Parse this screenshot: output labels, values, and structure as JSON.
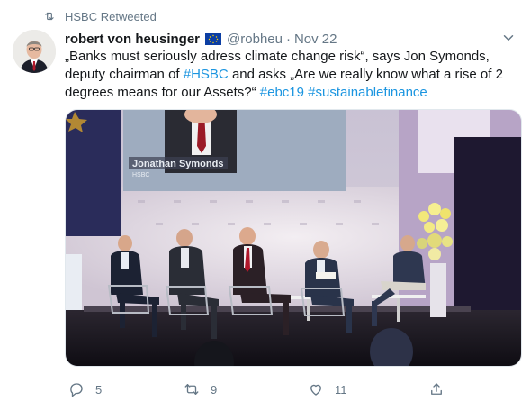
{
  "retweet": {
    "label": "HSBC Retweeted",
    "icon": "retweet-icon"
  },
  "author": {
    "display_name": "robert von heusinger",
    "flag_icon": "eu-flag-icon",
    "handle": "@robheu",
    "separator": "·",
    "time": "Nov 22"
  },
  "tweet": {
    "text_part1": "„Banks must seriously adress climate change risk“, says Jon Symonds, deputy chairman of ",
    "mention": "#HSBC",
    "text_part2": " and asks „Are we really know what a rise of 2 degrees means for our Assets?“ ",
    "hashtag1": "#ebc19",
    "hashtag2": "#sustainablefinance"
  },
  "media": {
    "screen_name_text": "Jonathan Symonds",
    "screen_sub_text": "HSBC"
  },
  "actions": {
    "reply_count": "5",
    "retweet_count": "9",
    "like_count": "11"
  },
  "colors": {
    "link": "#1b95e0",
    "muted": "#657786",
    "text": "#14171a"
  }
}
